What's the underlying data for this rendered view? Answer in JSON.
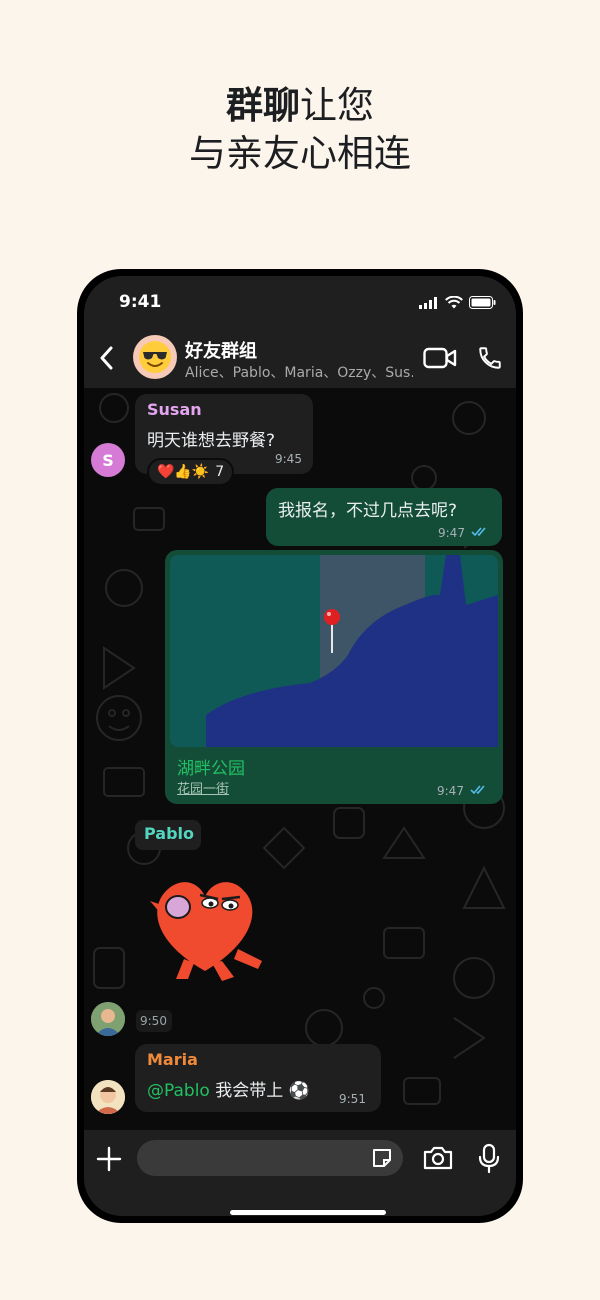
{
  "headline": {
    "bold": "群聊",
    "rest": "让您",
    "line2": "与亲友心相连"
  },
  "status_bar": {
    "time": "9:41"
  },
  "chat_header": {
    "title": "好友群组",
    "members": "Alice、Pablo、Maria、Ozzy、Sus...",
    "avatar_emoji": "😎"
  },
  "messages": {
    "susan": {
      "sender": "Susan",
      "sender_color": "#e3a4f0",
      "text": "明天谁想去野餐?",
      "time": "9:45",
      "avatar_letter": "S",
      "reactions": {
        "emojis": "❤️👍☀️",
        "count": "7"
      }
    },
    "me": {
      "text": "我报名，不过几点去呢?",
      "time": "9:47"
    },
    "location": {
      "title": "湖畔公园",
      "subtitle": "花园一街",
      "time": "9:47"
    },
    "pablo": {
      "sender": "Pablo",
      "sender_color": "#53d6c0",
      "time": "9:50"
    },
    "maria": {
      "sender": "Maria",
      "sender_color": "#f08a3b",
      "mention": "@Pablo",
      "text": " 我会带上 ⚽",
      "time": "9:51"
    }
  },
  "colors": {
    "accent_green": "#25d366",
    "outgoing_bubble": "#134d37",
    "incoming_bubble": "#1f1f1f",
    "read_tick": "#53bdeb",
    "mention": "#21c063"
  }
}
